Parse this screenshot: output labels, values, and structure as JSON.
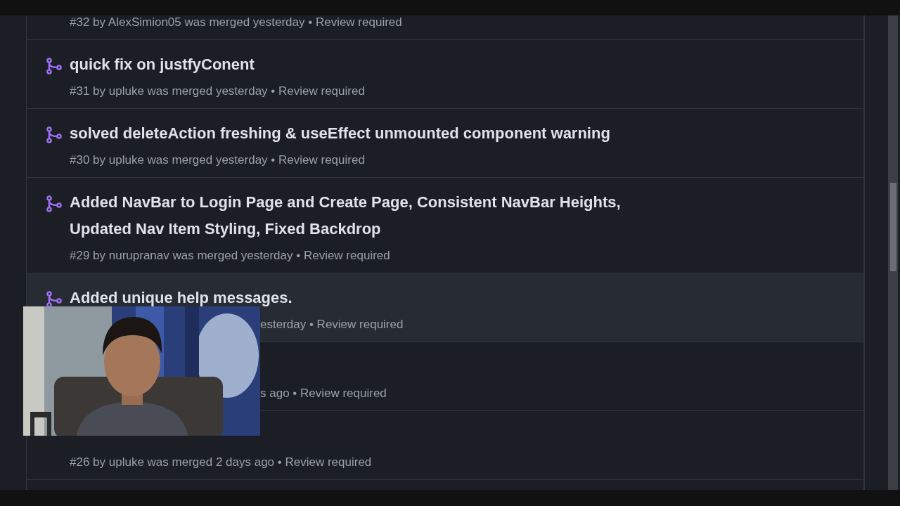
{
  "pull_requests": [
    {
      "meta": "#32 by AlexSimion05 was merged yesterday • Review required",
      "hovered": false,
      "occluded": false
    },
    {
      "title": "quick fix on justfyConent",
      "meta": "#31 by upluke was merged yesterday • Review required",
      "hovered": false,
      "occluded": false
    },
    {
      "title": "solved deleteAction freshing & useEffect unmounted component warning",
      "meta": "#30 by upluke was merged yesterday • Review required",
      "hovered": false,
      "occluded": false
    },
    {
      "title": "Added NavBar to Login Page and Create Page, Consistent NavBar Heights, Updated Nav Item Styling, Fixed Backdrop",
      "meta": "#29 by nurupranav was merged yesterday • Review required",
      "hovered": false,
      "occluded": false
    },
    {
      "title": "Added unique help messages.",
      "meta": "esterday • Review required",
      "hovered": true,
      "occluded": true
    },
    {
      "meta": "s ago • Review required",
      "hovered": false,
      "occluded": true
    },
    {
      "meta": "#26 by upluke was merged 2 days ago • Review required",
      "hovered": false,
      "occluded": false
    }
  ]
}
